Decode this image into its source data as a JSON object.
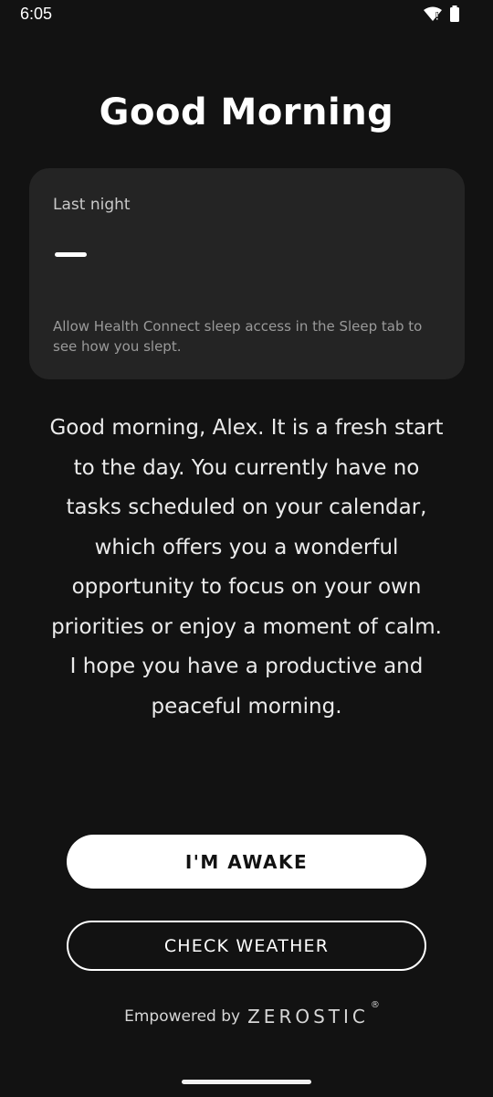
{
  "status_bar": {
    "time": "6:05",
    "icons": [
      "wifi-alert-icon",
      "battery-icon"
    ]
  },
  "greeting": {
    "title": "Good Morning"
  },
  "sleep_card": {
    "label": "Last night",
    "value": "—",
    "hint": "Allow Health Connect sleep access in the Sleep tab to see how you slept."
  },
  "message": "Good morning, Alex. It is a fresh start to the day. You currently have no tasks scheduled on your calendar, which offers you a wonderful opportunity to focus on your own priorities or enjoy a moment of calm. I hope you have a productive and peaceful morning.",
  "buttons": {
    "awake_label": "I'M AWAKE",
    "weather_label": "CHECK WEATHER"
  },
  "footer": {
    "prefix": "Empowered by",
    "brand": "ZEROSTIC",
    "brand_mark": "®"
  },
  "colors": {
    "background": "#121212",
    "card": "#242424",
    "primary": "#ffffff"
  }
}
